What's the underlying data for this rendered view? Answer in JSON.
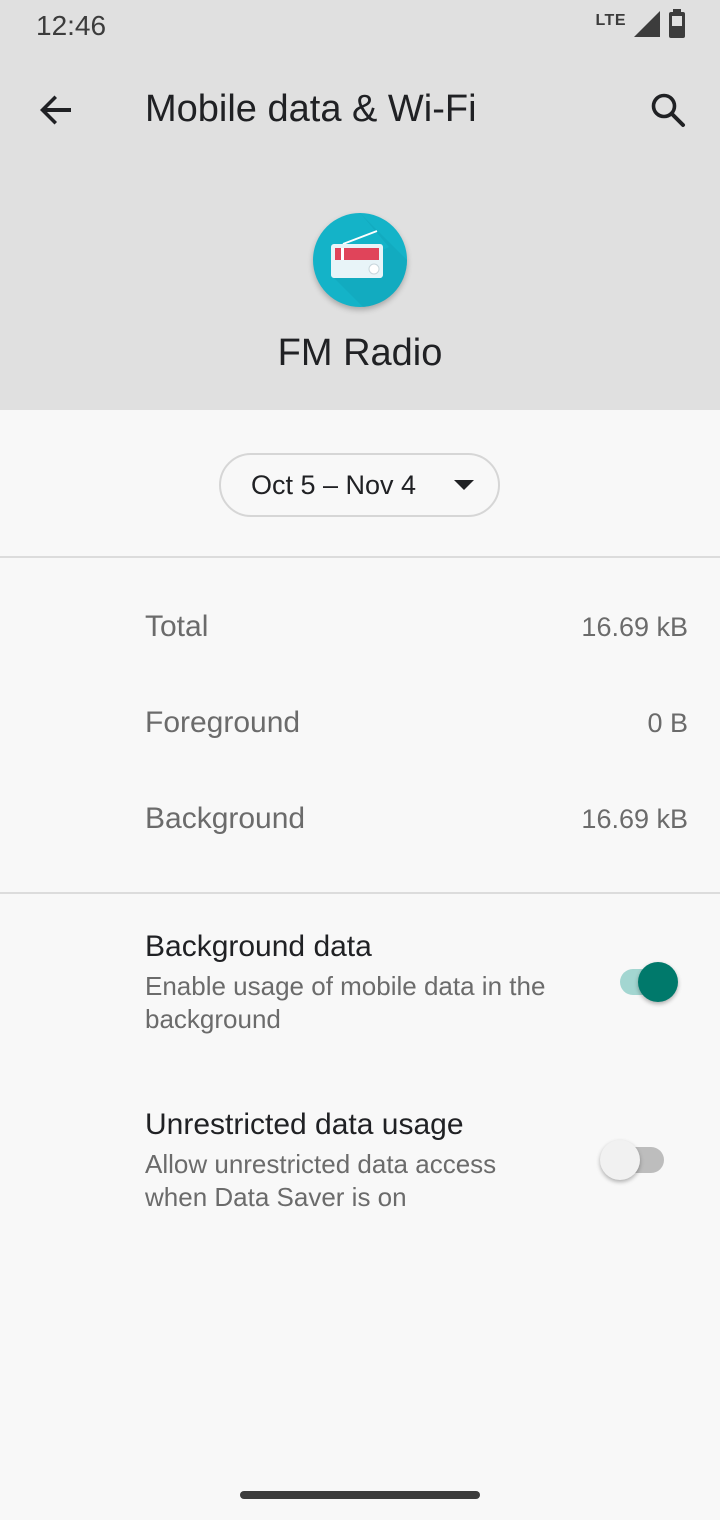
{
  "status_bar": {
    "time": "12:46",
    "network_label": "LTE",
    "signal_icon": "signal-icon",
    "battery_icon": "battery-icon"
  },
  "toolbar": {
    "title": "Mobile data & Wi-Fi",
    "back_icon": "back-arrow-icon",
    "search_icon": "search-icon"
  },
  "app": {
    "name": "FM Radio",
    "icon": "radio-icon",
    "icon_color": "#14b3c8"
  },
  "date_range": {
    "label": "Oct 5 – Nov 4"
  },
  "usage": [
    {
      "label": "Total",
      "value": "16.69 kB"
    },
    {
      "label": "Foreground",
      "value": "0 B"
    },
    {
      "label": "Background",
      "value": "16.69 kB"
    }
  ],
  "settings": [
    {
      "title": "Background data",
      "description": "Enable usage of mobile data in the background",
      "enabled": true
    },
    {
      "title": "Unrestricted data usage",
      "description": "Allow unrestricted data access when Data Saver is on",
      "enabled": false
    }
  ],
  "colors": {
    "accent": "#00796b",
    "accent_track": "#a3d6d1",
    "header_bg": "#e0e0e0"
  }
}
